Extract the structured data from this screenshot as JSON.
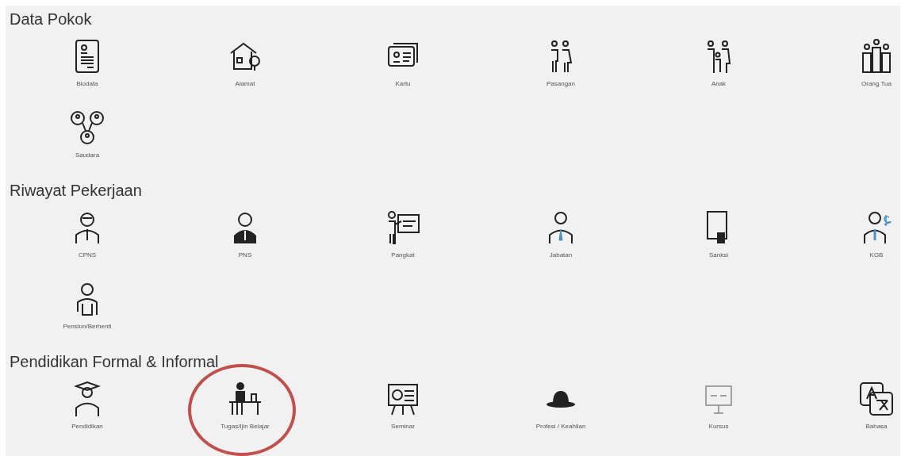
{
  "sections": [
    {
      "title": "Data Pokok",
      "items": [
        {
          "label": "Biodata",
          "kind": "document",
          "circled": false
        },
        {
          "label": "Alamat",
          "kind": "house",
          "circled": false
        },
        {
          "label": "Kartu",
          "kind": "idcard",
          "circled": false
        },
        {
          "label": "Pasangan",
          "kind": "couple",
          "circled": false
        },
        {
          "label": "Anak",
          "kind": "family",
          "circled": false
        },
        {
          "label": "Orang Tua",
          "kind": "group",
          "circled": false
        },
        {
          "label": "Saudara",
          "kind": "network",
          "circled": false
        }
      ]
    },
    {
      "title": "Riwayat Pekerjaan",
      "items": [
        {
          "label": "CPNS",
          "kind": "person",
          "circled": false
        },
        {
          "label": "PNS",
          "kind": "suit",
          "circled": false
        },
        {
          "label": "Pangkat",
          "kind": "presenter",
          "circled": false
        },
        {
          "label": "Jabatan",
          "kind": "tie",
          "circled": false
        },
        {
          "label": "Sanksi",
          "kind": "tablet",
          "circled": false
        },
        {
          "label": "KGB",
          "kind": "salary",
          "circled": false
        },
        {
          "label": "Pensiun/Berhenti",
          "kind": "elder",
          "circled": false
        }
      ]
    },
    {
      "title": "Pendidikan Formal & Informal",
      "items": [
        {
          "label": "Pendidikan",
          "kind": "graduate",
          "circled": false
        },
        {
          "label": "Tugas/Ijin Belajar",
          "kind": "desk",
          "circled": true
        },
        {
          "label": "Seminar",
          "kind": "projector",
          "circled": false
        },
        {
          "label": "Profesi / Keahlian",
          "kind": "hat",
          "circled": false
        },
        {
          "label": "Kursus",
          "kind": "board",
          "circled": false
        },
        {
          "label": "Bahasa",
          "kind": "translate",
          "circled": false
        }
      ]
    }
  ]
}
